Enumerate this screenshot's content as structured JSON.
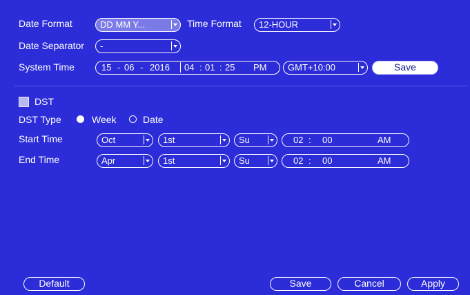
{
  "general": {
    "date_format_label": "Date Format",
    "date_format_value": "DD MM Y...",
    "time_format_label": "Time Format",
    "time_format_value": "12-HOUR",
    "date_separator_label": "Date Separator",
    "date_separator_value": "-",
    "system_time_label": "System Time",
    "system_time": {
      "day": "15",
      "month": "06",
      "year": "2016",
      "hour": "04",
      "minute": "01",
      "second": "25",
      "ampm": "PM",
      "sep_date": "-",
      "sep_time": ":"
    },
    "timezone_value": "GMT+10:00",
    "save_label": "Save"
  },
  "dst": {
    "label": "DST",
    "enabled": false,
    "type_label": "DST Type",
    "type_week": "Week",
    "type_date": "Date",
    "selected_type": "Week",
    "start_label": "Start Time",
    "end_label": "End Time",
    "start": {
      "month": "Oct",
      "week": "1st",
      "day": "Su",
      "hour": "02",
      "minute": "00",
      "ampm": "AM"
    },
    "end": {
      "month": "Apr",
      "week": "1st",
      "day": "Su",
      "hour": "02",
      "minute": "00",
      "ampm": "AM"
    },
    "time_sep": ":"
  },
  "footer": {
    "default_label": "Default",
    "save_label": "Save",
    "cancel_label": "Cancel",
    "apply_label": "Apply"
  },
  "colors": {
    "background": "#2c2cd8",
    "text": "#ffffff",
    "highlight": "#7b7be8"
  }
}
